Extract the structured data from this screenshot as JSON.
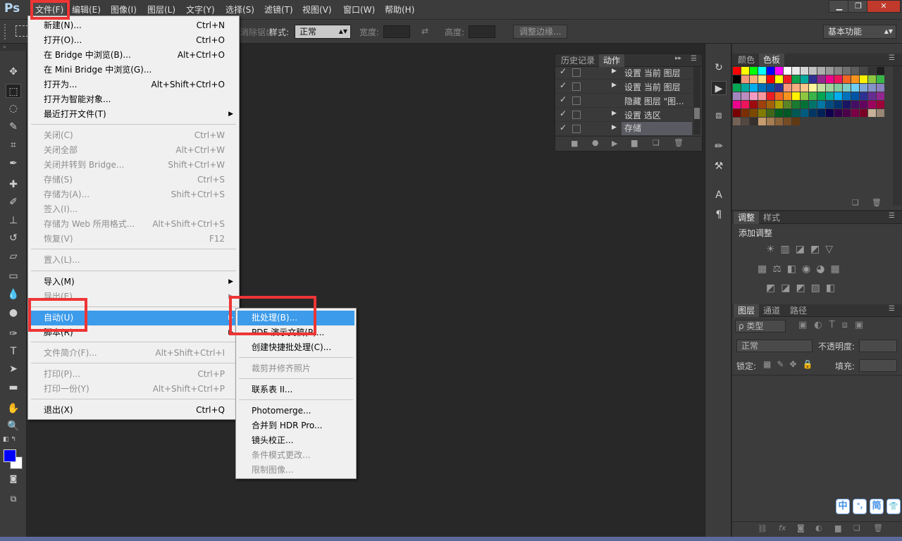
{
  "app": {
    "logo": "Ps"
  },
  "menubar": {
    "items": [
      "文件(F)",
      "编辑(E)",
      "图像(I)",
      "图层(L)",
      "文字(Y)",
      "选择(S)",
      "滤镜(T)",
      "视图(V)",
      "窗口(W)",
      "帮助(H)"
    ]
  },
  "window_controls": {
    "minimize": "▁",
    "restore": "❐",
    "close": "✕"
  },
  "options": {
    "style_label": "样式:",
    "style_value": "正常",
    "width_label": "宽度:",
    "height_label": "高度:",
    "refine_button": "调整边缘...",
    "hidden_text": "消除锯齿",
    "workspace": "基本功能"
  },
  "file_menu": [
    {
      "label": "新建(N)...",
      "shortcut": "Ctrl+N",
      "disabled": false
    },
    {
      "label": "打开(O)...",
      "shortcut": "Ctrl+O",
      "disabled": false
    },
    {
      "label": "在 Bridge 中浏览(B)...",
      "shortcut": "Alt+Ctrl+O",
      "disabled": false
    },
    {
      "label": "在 Mini Bridge 中浏览(G)...",
      "shortcut": "",
      "disabled": false
    },
    {
      "label": "打开为...",
      "shortcut": "Alt+Shift+Ctrl+O",
      "disabled": false
    },
    {
      "label": "打开为智能对象...",
      "shortcut": "",
      "disabled": false
    },
    {
      "label": "最近打开文件(T)",
      "shortcut": "",
      "disabled": false,
      "submenu": true
    },
    {
      "label": "关闭(C)",
      "shortcut": "Ctrl+W",
      "disabled": true
    },
    {
      "label": "关闭全部",
      "shortcut": "Alt+Ctrl+W",
      "disabled": true
    },
    {
      "label": "关闭并转到 Bridge...",
      "shortcut": "Shift+Ctrl+W",
      "disabled": true
    },
    {
      "label": "存储(S)",
      "shortcut": "Ctrl+S",
      "disabled": true
    },
    {
      "label": "存储为(A)...",
      "shortcut": "Shift+Ctrl+S",
      "disabled": true
    },
    {
      "label": "签入(I)...",
      "shortcut": "",
      "disabled": true
    },
    {
      "label": "存储为 Web 所用格式...",
      "shortcut": "Alt+Shift+Ctrl+S",
      "disabled": true
    },
    {
      "label": "恢复(V)",
      "shortcut": "F12",
      "disabled": true
    },
    {
      "label": "置入(L)...",
      "shortcut": "",
      "disabled": true
    },
    {
      "label": "导入(M)",
      "shortcut": "",
      "disabled": false,
      "submenu": true
    },
    {
      "label": "导出(E)",
      "shortcut": "",
      "disabled": true,
      "submenu": true
    },
    {
      "label": "自动(U)",
      "shortcut": "",
      "disabled": false,
      "submenu": true,
      "highlighted": true
    },
    {
      "label": "脚本(R)",
      "shortcut": "",
      "disabled": false,
      "submenu": true
    },
    {
      "label": "文件简介(F)...",
      "shortcut": "Alt+Shift+Ctrl+I",
      "disabled": true
    },
    {
      "label": "打印(P)...",
      "shortcut": "Ctrl+P",
      "disabled": true
    },
    {
      "label": "打印一份(Y)",
      "shortcut": "Alt+Shift+Ctrl+P",
      "disabled": true
    },
    {
      "label": "退出(X)",
      "shortcut": "Ctrl+Q",
      "disabled": false
    }
  ],
  "automate_menu": [
    {
      "label": "批处理(B)...",
      "disabled": false,
      "highlighted": true
    },
    {
      "label": "PDF 演示文稿(P)...",
      "disabled": false
    },
    {
      "label": "创建快捷批处理(C)...",
      "disabled": false
    },
    {
      "label": "裁剪并修齐照片",
      "disabled": true
    },
    {
      "label": "联系表 II...",
      "disabled": false
    },
    {
      "label": "Photomerge...",
      "disabled": false
    },
    {
      "label": "合并到 HDR Pro...",
      "disabled": false
    },
    {
      "label": "镜头校正...",
      "disabled": false
    },
    {
      "label": "条件模式更改...",
      "disabled": true
    },
    {
      "label": "限制图像...",
      "disabled": true
    }
  ],
  "actions_panel": {
    "tabs": [
      "历史记录",
      "动作"
    ],
    "rows": [
      "设置 当前 图层",
      "设置 当前 图层",
      "隐藏 图层 \"图...",
      "设置 选区",
      "存储"
    ]
  },
  "swatches_panel": {
    "tabs": [
      "颜色",
      "色板"
    ],
    "colors": [
      "#ff0000",
      "#ffff00",
      "#00ff00",
      "#00ffff",
      "#0000ff",
      "#ff00ff",
      "#ffffff",
      "#ebebeb",
      "#d6d6d6",
      "#c2c2c2",
      "#adadad",
      "#999999",
      "#858585",
      "#707070",
      "#5c5c5c",
      "#474747",
      "#333333",
      "#1f1f1f",
      "#000000",
      "#f2977a",
      "#f6ae7a",
      "#ffe082",
      "#ff0000",
      "#ffff00",
      "#ed1c24",
      "#0fa14b",
      "#00a99d",
      "#2e3192",
      "#92278f",
      "#ec008c",
      "#ed145b",
      "#f26522",
      "#f7941d",
      "#fff200",
      "#8dc63f",
      "#39b54a",
      "#00a651",
      "#00a99d",
      "#00aeef",
      "#0072bc",
      "#0054a6",
      "#2e3192",
      "#f7977a",
      "#f9ad81",
      "#fdc68a",
      "#fff79a",
      "#c4df9b",
      "#a3d39c",
      "#82ca9d",
      "#7bcdc8",
      "#6ecff6",
      "#7ea7d8",
      "#8493ca",
      "#8882be",
      "#a187be",
      "#bc8dbf",
      "#f49ac2",
      "#f6989d",
      "#ed1c24",
      "#f26522",
      "#f7941d",
      "#fff200",
      "#8dc63f",
      "#39b54a",
      "#00a651",
      "#00a99d",
      "#00aeef",
      "#0072bc",
      "#0054a6",
      "#2e3192",
      "#662d91",
      "#92278f",
      "#ec008c",
      "#ed145b",
      "#9e0b0f",
      "#a0410d",
      "#a3620a",
      "#aba000",
      "#598527",
      "#1a7b30",
      "#007236",
      "#00746b",
      "#0076a3",
      "#004b80",
      "#003471",
      "#1b1464",
      "#440e62",
      "#630460",
      "#9e005d",
      "#9e0039",
      "#790000",
      "#7b2e00",
      "#7d4900",
      "#827b00",
      "#406618",
      "#005e20",
      "#005826",
      "#005952",
      "#005b7f",
      "#003663",
      "#002157",
      "#0d004c",
      "#32004b",
      "#4b0049",
      "#7b0046",
      "#7a0026",
      "#c7b299",
      "#998675",
      "#736357",
      "#534741",
      "#37302d",
      "#c69c6d",
      "#a67c52",
      "#8c6239",
      "#754c24",
      "#603913"
    ]
  },
  "adjustments_panel": {
    "tabs": [
      "调整",
      "样式"
    ],
    "title": "添加调整"
  },
  "layers_panel": {
    "tabs": [
      "图层",
      "通道",
      "路径"
    ],
    "filter": "ρ 类型",
    "blend_mode": "正常",
    "opacity_label": "不透明度:",
    "lock_label": "锁定:",
    "fill_label": "填充:"
  },
  "ime": [
    "中",
    "°,",
    "简",
    "👕"
  ]
}
